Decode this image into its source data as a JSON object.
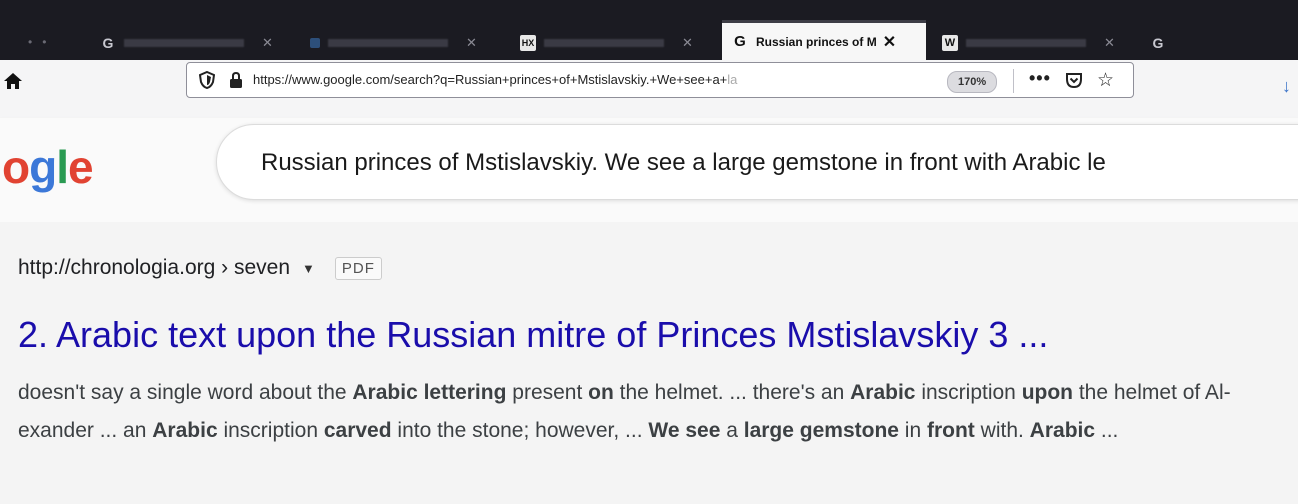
{
  "tabs": [
    {
      "favicon": "G",
      "title": "",
      "active": false
    },
    {
      "favicon": "",
      "title": "",
      "active": false
    },
    {
      "favicon": "HX",
      "title": "",
      "active": false
    },
    {
      "favicon": "G",
      "title": "Russian princes of M",
      "active": true
    },
    {
      "favicon": "W",
      "title": "",
      "active": false
    },
    {
      "favicon": "G",
      "title": "",
      "active": false
    }
  ],
  "tab_close": "✕",
  "navbar": {
    "url_main": "https://www.google.com/search?q=Russian+princes+of+Mstislavskiy.+We+see+a+",
    "url_fade": "la",
    "zoom": "170%",
    "more": "•••"
  },
  "logo": {
    "o": "o",
    "g": "g",
    "l": "l",
    "e": "e"
  },
  "search": {
    "query": "Russian princes of Mstislavskiy. We see a large gemstone in front with Arabic le"
  },
  "result": {
    "cite": "http://chronologia.org › seven",
    "caret": "▼",
    "badge": "PDF",
    "title": "2. Arabic text upon the Russian mitre of Princes Mstislavskiy 3 ...",
    "snippet": [
      {
        "t": "doesn't say a single word about the ",
        "b": false
      },
      {
        "t": "Arabic lettering",
        "b": true
      },
      {
        "t": " present ",
        "b": false
      },
      {
        "t": "on",
        "b": true
      },
      {
        "t": " the helmet. ... there's an ",
        "b": false
      },
      {
        "t": "Arabic",
        "b": true
      },
      {
        "t": " inscription ",
        "b": false
      },
      {
        "t": "upon",
        "b": true
      },
      {
        "t": " the helmet of Al- exander ... an ",
        "b": false
      },
      {
        "t": "Arabic",
        "b": true
      },
      {
        "t": " inscription ",
        "b": false
      },
      {
        "t": "carved",
        "b": true
      },
      {
        "t": " into the stone; however, ... ",
        "b": false
      },
      {
        "t": "We see",
        "b": true
      },
      {
        "t": " a ",
        "b": false
      },
      {
        "t": "large gemstone",
        "b": true
      },
      {
        "t": " in ",
        "b": false
      },
      {
        "t": "front",
        "b": true
      },
      {
        "t": " with. ",
        "b": false
      },
      {
        "t": "Arabic",
        "b": true
      },
      {
        "t": " ...",
        "b": false
      }
    ]
  },
  "colors": {
    "link": "#1a0dab",
    "tabstrip": "#1b1b22",
    "accent": "#3b73c9"
  }
}
